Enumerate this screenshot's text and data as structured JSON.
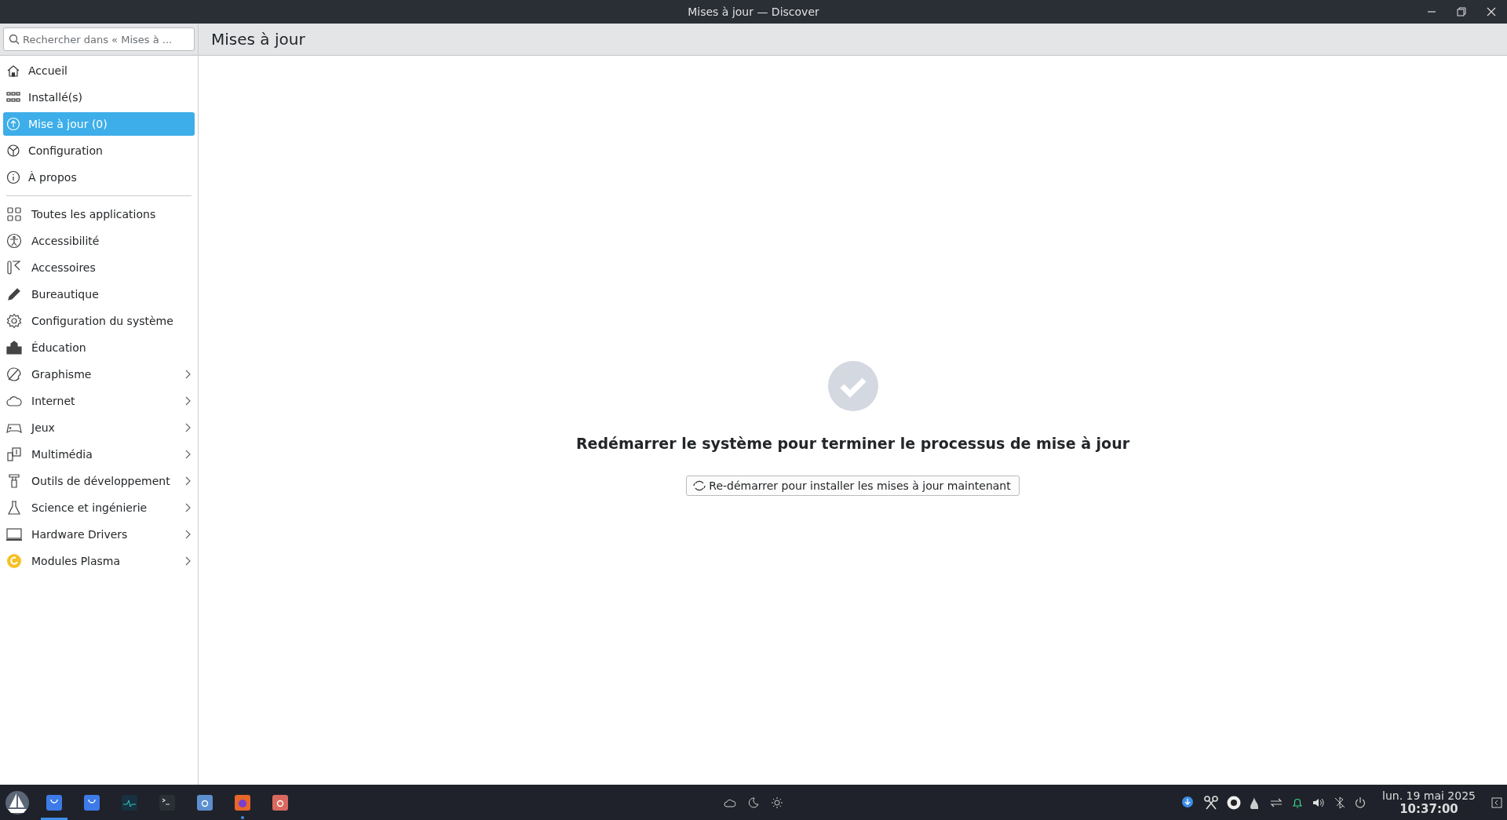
{
  "window": {
    "title": "Mises à jour — Discover"
  },
  "search": {
    "placeholder": "Rechercher dans « Mises à ..."
  },
  "page_title": "Mises à jour",
  "nav": [
    {
      "label": "Accueil",
      "selected": false
    },
    {
      "label": "Installé(s)",
      "selected": false
    },
    {
      "label": "Mise à jour (0)",
      "selected": true
    },
    {
      "label": "Configuration",
      "selected": false
    },
    {
      "label": "À propos",
      "selected": false
    }
  ],
  "categories": [
    {
      "label": "Toutes les applications",
      "has_children": false
    },
    {
      "label": "Accessibilité",
      "has_children": false
    },
    {
      "label": "Accessoires",
      "has_children": false
    },
    {
      "label": "Bureautique",
      "has_children": false
    },
    {
      "label": "Configuration du système",
      "has_children": false
    },
    {
      "label": "Éducation",
      "has_children": false
    },
    {
      "label": "Graphisme",
      "has_children": true
    },
    {
      "label": "Internet",
      "has_children": true
    },
    {
      "label": "Jeux",
      "has_children": true
    },
    {
      "label": "Multimédia",
      "has_children": true
    },
    {
      "label": "Outils de développement",
      "has_children": true
    },
    {
      "label": "Science et ingénierie",
      "has_children": true
    },
    {
      "label": "Hardware Drivers",
      "has_children": true
    },
    {
      "label": "Modules Plasma",
      "has_children": true
    }
  ],
  "message": "Redémarrer le système pour terminer le processus de mise à jour",
  "restart_button": "Re-démarrer pour installer les mises à jour maintenant",
  "taskbar": {
    "tasks": [
      {
        "active": true,
        "running": true
      },
      {
        "active": false,
        "running": false
      },
      {
        "active": false,
        "running": false
      },
      {
        "active": false,
        "running": false
      },
      {
        "active": false,
        "running": false
      },
      {
        "active": false,
        "running": true
      },
      {
        "active": false,
        "running": false
      }
    ],
    "date": "lun. 19 mai 2025",
    "time": "10:37:00"
  }
}
